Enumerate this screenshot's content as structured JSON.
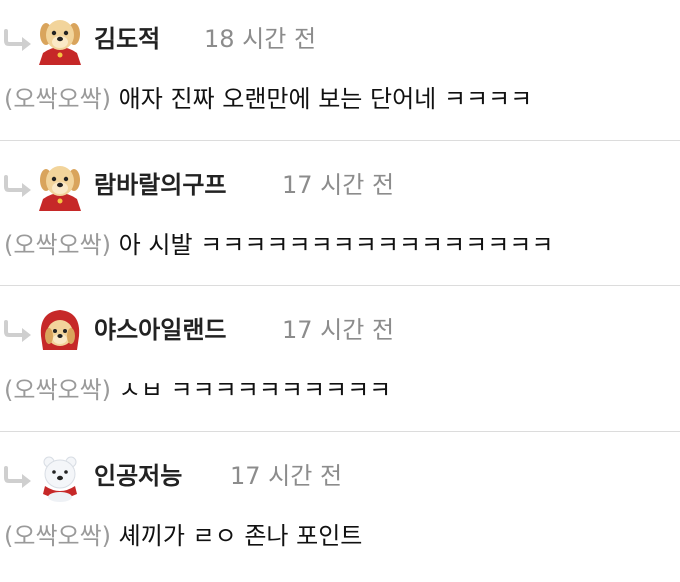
{
  "comments": [
    {
      "author": "김도적",
      "time": "18 시간 전",
      "tag": "(오싹오싹)",
      "text": " 애자 진짜 오랜만에 보는 단어네 ㅋㅋㅋㅋ",
      "avatar": "puppy-cape-icon"
    },
    {
      "author": "람바랄의구프",
      "time": "17 시간 전",
      "tag": "(오싹오싹)",
      "text": " 아 시발 ㅋㅋㅋㅋㅋㅋㅋㅋㅋㅋㅋㅋㅋㅋㅋㅋ",
      "avatar": "puppy-cape-icon"
    },
    {
      "author": "야스아일랜드",
      "time": "17 시간 전",
      "tag": "(오싹오싹)",
      "text": " ㅅㅂ ㅋㅋㅋㅋㅋㅋㅋㅋㅋㅋ",
      "avatar": "puppy-hood-icon"
    },
    {
      "author": "인공저능",
      "time": "17 시간 전",
      "tag": "(오싹오싹)",
      "text": " 셰끼가 ㄹㅇ 존나 포인트",
      "avatar": "polar-bear-icon"
    }
  ],
  "colors": {
    "tag": "#9a9a9a",
    "time": "#8c8c8c",
    "author": "#222222",
    "divider": "#dcdcdc",
    "reply_icon": "#cfcfcf"
  }
}
